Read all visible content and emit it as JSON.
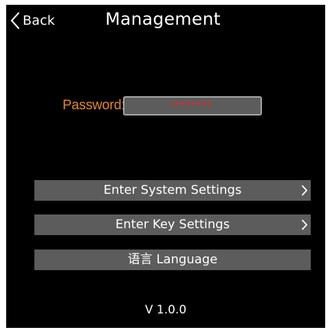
{
  "header": {
    "back_label": "Back",
    "back_icon": "chevron-left-icon",
    "title": "Management"
  },
  "password": {
    "label": "Password:",
    "value": "********",
    "masked_color": "#ee2424",
    "label_color": "#e6862c"
  },
  "menu": {
    "items": [
      {
        "label": "Enter System Settings",
        "icon": "chevron-right-icon"
      },
      {
        "label": "Enter Key Settings",
        "icon": "chevron-right-icon"
      },
      {
        "label": "语言 Language"
      }
    ]
  },
  "footer": {
    "version": "V 1.0.0"
  }
}
